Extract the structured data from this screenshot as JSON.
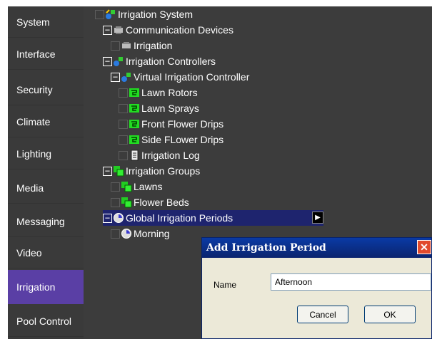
{
  "sidebar": {
    "items": [
      {
        "label": "System"
      },
      {
        "label": "Interface"
      },
      {
        "label": "Security"
      },
      {
        "label": "Climate"
      },
      {
        "label": "Lighting"
      },
      {
        "label": "Media"
      },
      {
        "label": "Messaging"
      },
      {
        "label": "Video"
      },
      {
        "label": "Irrigation",
        "active": true
      },
      {
        "label": "Pool Control"
      }
    ]
  },
  "tree": {
    "root": "Irrigation System",
    "communication_devices": "Communication Devices",
    "comm_irrigation": "Irrigation",
    "irrigation_controllers": "Irrigation Controllers",
    "virtual_controller": "Virtual Irrigation Controller",
    "lawn_rotors": "Lawn Rotors",
    "lawn_sprays": "Lawn Sprays",
    "front_flower_drips": "Front Flower Drips",
    "side_flower_drips": "Side FLower Drips",
    "irrigation_log": "Irrigation Log",
    "irrigation_groups": "Irrigation Groups",
    "lawns": "Lawns",
    "flower_beds": "Flower Beds",
    "global_periods": "Global Irrigation Periods",
    "morning": "Morning"
  },
  "dialog": {
    "title": "Add Irrigation Period",
    "name_label": "Name",
    "name_value": "Afternoon",
    "cancel_label": "Cancel",
    "ok_label": "OK"
  }
}
